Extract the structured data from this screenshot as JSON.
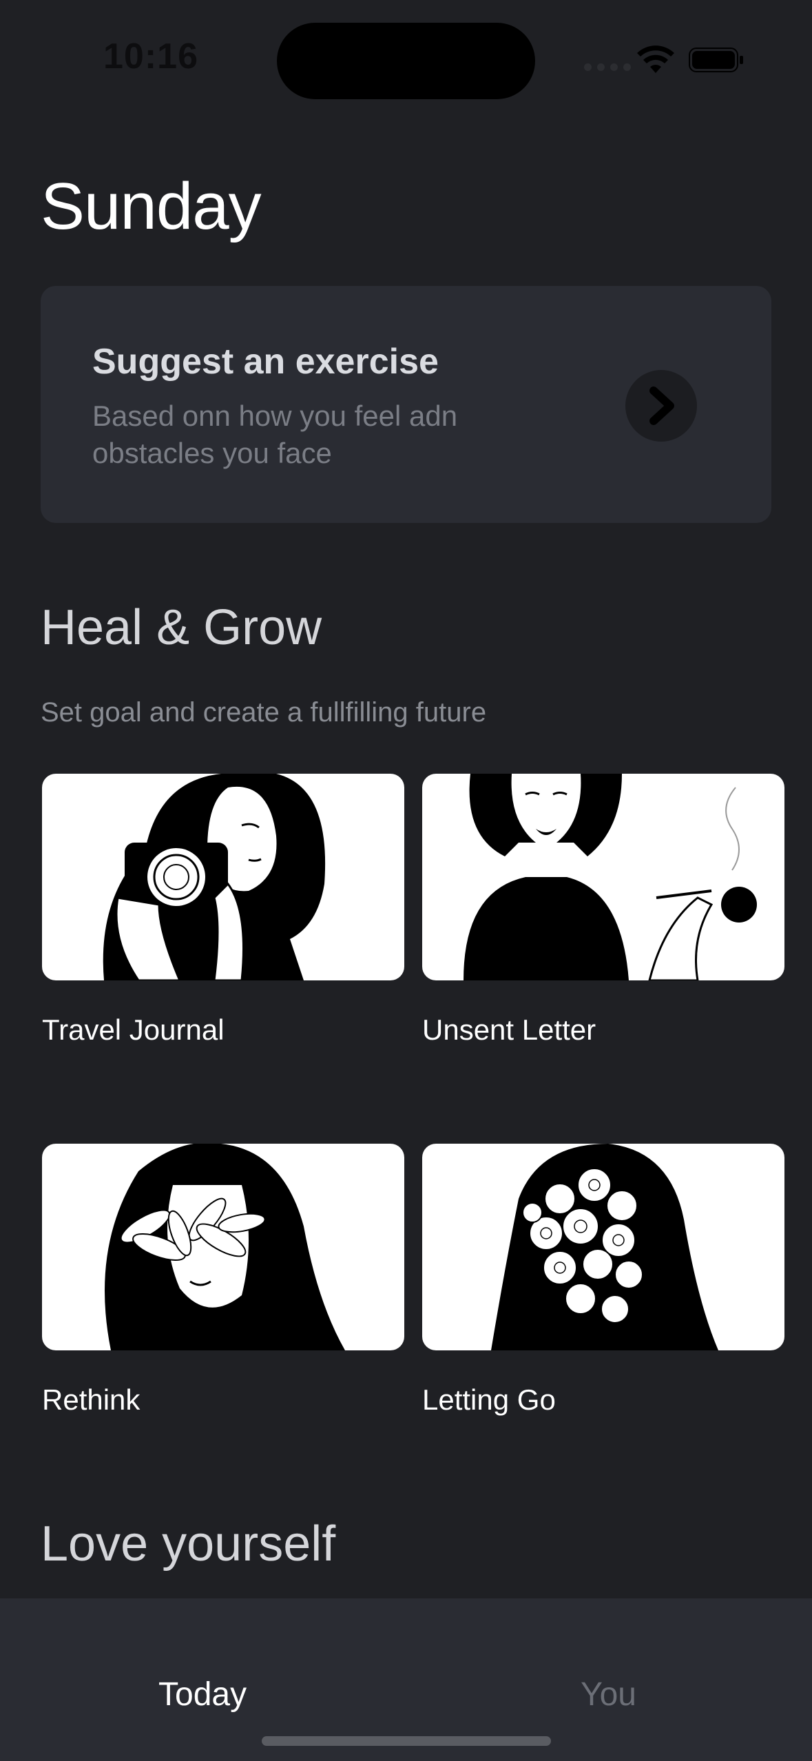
{
  "status_bar": {
    "time": "10:16"
  },
  "header": {
    "title": "Sunday"
  },
  "suggest_card": {
    "title": "Suggest an exercise",
    "subtitle": "Based onn how you feel adn obstacles you face"
  },
  "sections": [
    {
      "title": "Heal & Grow",
      "subtitle": "Set goal and create a fullfilling future",
      "items": [
        {
          "label": "Travel Journal",
          "image": "woman-camera-rose-illustration"
        },
        {
          "label": "Unsent Letter",
          "image": "woman-holding-rose-illustration"
        },
        {
          "label": "Rethink",
          "image": "woman-lily-eyes-illustration"
        },
        {
          "label": "Letting Go",
          "image": "woman-flower-face-illustration"
        }
      ]
    },
    {
      "title": "Love yourself"
    }
  ],
  "tab_bar": {
    "tabs": [
      {
        "label": "Today",
        "active": true
      },
      {
        "label": "You",
        "active": false
      }
    ]
  }
}
